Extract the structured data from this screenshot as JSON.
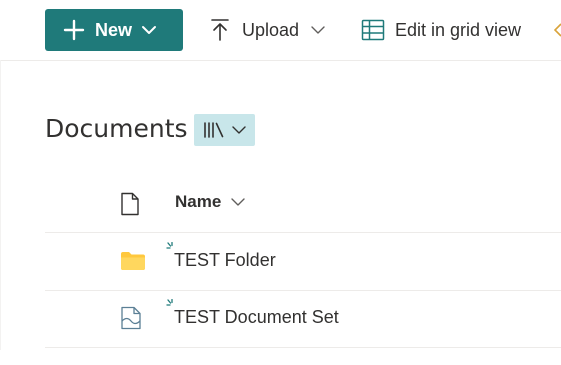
{
  "commandbar": {
    "new_label": "New",
    "upload_label": "Upload",
    "grid_view_label": "Edit in grid view"
  },
  "library": {
    "title": "Documents",
    "view_icon": "library-view-icon"
  },
  "list": {
    "columns": [
      {
        "icon": "file-type-icon",
        "label": ""
      },
      {
        "label": "Name"
      }
    ],
    "items": [
      {
        "icon": "folder-icon",
        "name": "TEST Folder",
        "is_new": true
      },
      {
        "icon": "document-set-icon",
        "name": "TEST Document Set",
        "is_new": true
      }
    ]
  },
  "colors": {
    "accent": "#1f7a7a",
    "view_switch_bg": "#c8e6ea",
    "folder": "#ffc83d",
    "divider": "#edebe9",
    "text": "#323130"
  }
}
